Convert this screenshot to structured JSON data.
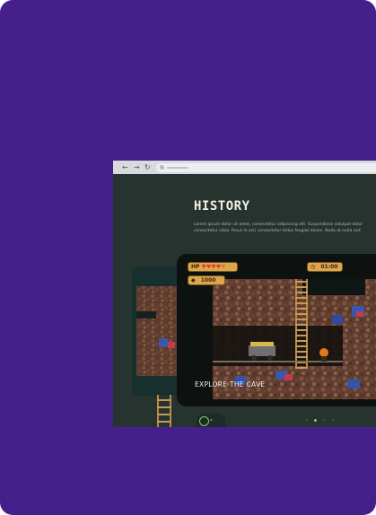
{
  "page": {
    "background_color": "#45208b",
    "accent_color": "#7bd36a"
  },
  "browser": {
    "nav_icons": [
      "back-arrow-icon",
      "forward-arrow-icon",
      "reload-icon"
    ],
    "back_glyph": "←",
    "forward_glyph": "→",
    "reload_glyph": "↻"
  },
  "section": {
    "title": "HISTORY",
    "body_lines": [
      "Lorem ipsum dolor sit amet, consectetur adipiscing elit. Suspendisse volutpat dolor",
      "consectetur vitae. Risus in orci consectetur tellus feugiat donec. Nulla ut nulla sed"
    ]
  },
  "game": {
    "hp_label": "HP",
    "hearts_full": 4,
    "hearts_total": 5,
    "timer": "01:00",
    "coins": "1000",
    "caption": "EXPLORE THE CAVE"
  },
  "carousel": {
    "active_index": 1,
    "dots": 4
  }
}
